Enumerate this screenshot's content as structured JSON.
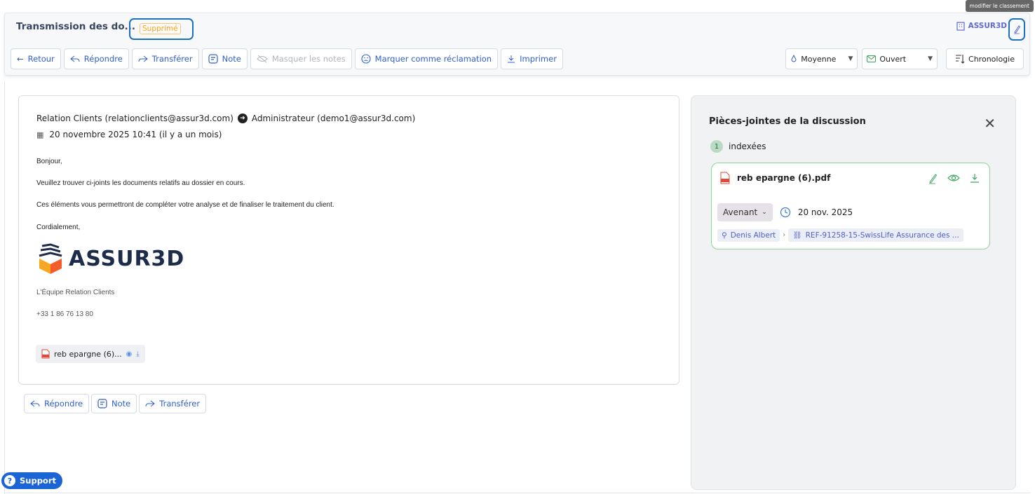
{
  "header": {
    "title": "Transmission des do...",
    "status_badge": "Supprimé",
    "org_name": "ASSUR3D",
    "tooltip": "modifier le classement"
  },
  "toolbar": {
    "back": "Retour",
    "reply": "Répondre",
    "forward": "Transférer",
    "note": "Note",
    "hide_notes": "Masquer les notes",
    "mark_claim": "Marquer comme réclamation",
    "print": "Imprimer",
    "priority": "Moyenne",
    "state": "Ouvert",
    "timeline": "Chronologie"
  },
  "message": {
    "from": "Relation Clients (relationclients@assur3d.com)",
    "to": "Administrateur (demo1@assur3d.com)",
    "date": "20 novembre 2025 10:41 (il y a un mois)",
    "lines": [
      "Bonjour,",
      "Veuillez trouver ci-joints les documents relatifs au dossier en cours.",
      "Ces éléments vous permettront de compléter votre analyse et de finaliser le traitement du client.",
      "Cordialement,"
    ],
    "logo_text": "ASSUR3D",
    "signature_team": "L'Équipe Relation Clients",
    "signature_phone": "+33 1 86 76 13 80",
    "attachment_chip": "reb epargne (6)..."
  },
  "bottom_actions": {
    "reply": "Répondre",
    "note": "Note",
    "forward": "Transférer"
  },
  "panel": {
    "title": "Pièces-jointes de la discussion",
    "indexed_count": "1",
    "indexed_label": "indexées",
    "attachment": {
      "name": "reb epargne (6).pdf",
      "type": "Avenant",
      "date": "20 nov. 2025",
      "person": "Denis Albert",
      "reference": "REF-91258-15-SwissLife Assurance des ..."
    }
  },
  "support": {
    "label": "Support"
  },
  "colors": {
    "accent": "#2f5fd0",
    "badge": "#f0a431",
    "highlight": "#1d6fc0",
    "attachment_border": "#8ed39a",
    "support": "#1b64d6"
  }
}
